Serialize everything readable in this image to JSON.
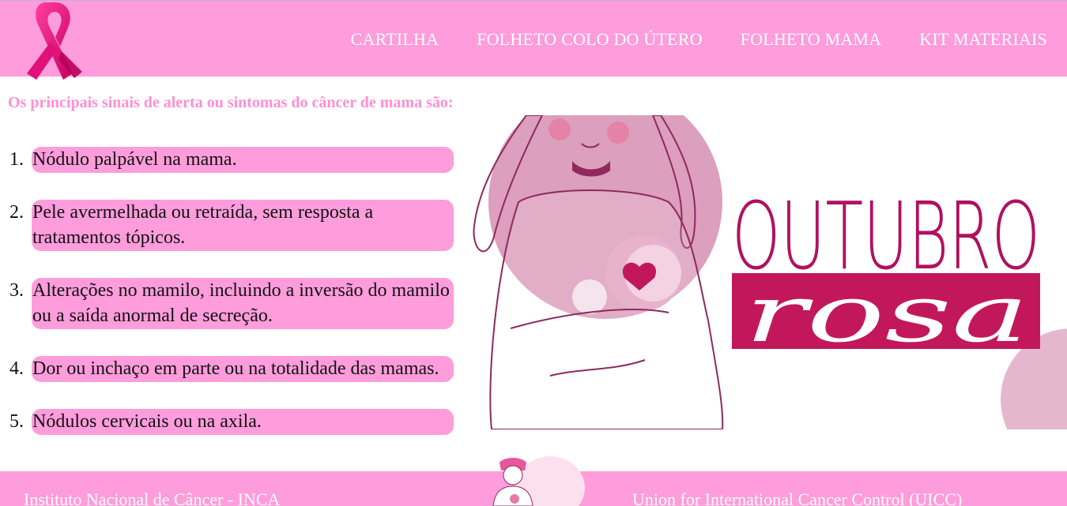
{
  "header": {
    "logo": "pink-ribbon-icon",
    "nav": [
      {
        "label": "CARTILHA"
      },
      {
        "label": "FOLHETO COLO DO ÚTERO"
      },
      {
        "label": "FOLHETO MAMA"
      },
      {
        "label": "KIT MATERIAIS"
      }
    ]
  },
  "main": {
    "title": "Os principais sinais de alerta ou sintomas do câncer de mama são:",
    "items": [
      {
        "num": "1.",
        "text": "Nódulo palpável na mama."
      },
      {
        "num": "2.",
        "text": "Pele avermelhada ou retraída, sem resposta a tratamentos tópicos."
      },
      {
        "num": "3.",
        "text": "Alterações no mamilo, incluindo a inversão do mamilo ou a saída anormal de secreção."
      },
      {
        "num": "4.",
        "text": "Dor ou inchaço em parte ou na totalidade das mamas."
      },
      {
        "num": "5.",
        "text": "Nódulos cervicais ou na axila."
      }
    ],
    "banner": {
      "title_top": "OUTUBRO",
      "title_bottom": "rosa"
    }
  },
  "footer": {
    "left": "Instituto Nacional de Câncer - INCA",
    "right": "Union for International Cancer Control (UICC)"
  },
  "colors": {
    "brand_pink": "#ff9cdc",
    "title_pink": "#ff8fd2",
    "ribbon": "#e0117a",
    "banner_magenta": "#c2185b",
    "illustration_pink": "#dc9fbe"
  }
}
